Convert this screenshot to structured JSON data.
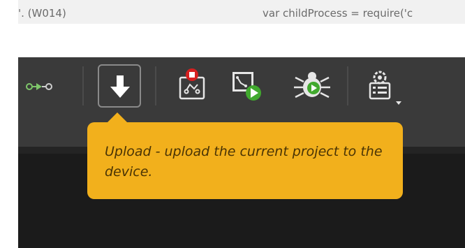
{
  "editor": {
    "warning_text": "'. (W014)",
    "code_text": "var childProcess = require('c"
  },
  "toolbar": {
    "items": [
      {
        "name": "connection-icon"
      },
      {
        "name": "upload-icon"
      },
      {
        "name": "stop-app-icon"
      },
      {
        "name": "run-app-icon"
      },
      {
        "name": "debug-bug-icon"
      },
      {
        "name": "settings-gear-icon"
      }
    ]
  },
  "tooltip": {
    "text": "Upload - upload the current project to the device."
  },
  "colors": {
    "toolbar_bg": "#3a3a3a",
    "tooltip_bg": "#f2b01c",
    "run_green": "#41a92e",
    "stop_red": "#d61f1f"
  }
}
